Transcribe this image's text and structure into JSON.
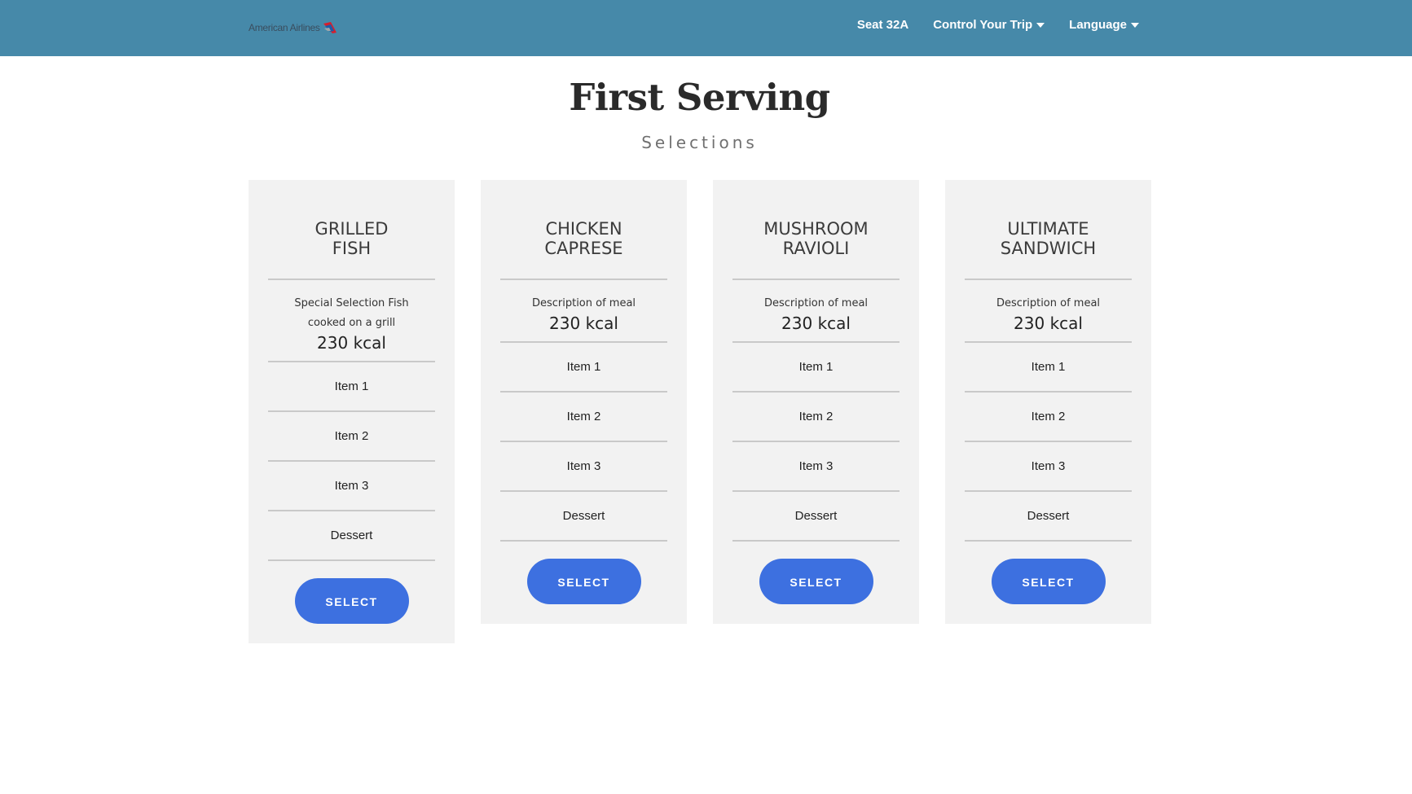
{
  "navbar": {
    "brand": "American Airlines",
    "brand_icon": "american-airlines-flight-symbol",
    "links": [
      {
        "label": "Seat 32A",
        "dropdown": false
      },
      {
        "label": "Control Your Trip",
        "dropdown": true
      },
      {
        "label": "Language",
        "dropdown": true
      }
    ],
    "background_color": "#4689a9"
  },
  "heading": {
    "title": "First Serving",
    "subtitle": "Selections"
  },
  "cards": [
    {
      "title_line1": "GRILLED",
      "title_line2": "FISH",
      "desc_line1": "Special Selection Fish",
      "desc_line2": "cooked on a grill",
      "kcal": "230 kcal",
      "items": [
        "Item 1",
        "Item 2",
        "Item 3",
        "Dessert"
      ],
      "button": "SELECT"
    },
    {
      "title_line1": "CHICKEN",
      "title_line2": "CAPRESE",
      "desc_line1": "Description of meal",
      "desc_line2": "",
      "kcal": "230 kcal",
      "items": [
        "Item 1",
        "Item 2",
        "Item 3",
        "Dessert"
      ],
      "button": "SELECT"
    },
    {
      "title_line1": "MUSHROOM",
      "title_line2": "RAVIOLI",
      "desc_line1": "Description of meal",
      "desc_line2": "",
      "kcal": "230 kcal",
      "items": [
        "Item 1",
        "Item 2",
        "Item 3",
        "Dessert"
      ],
      "button": "SELECT"
    },
    {
      "title_line1": "ULTIMATE",
      "title_line2": "SANDWICH",
      "desc_line1": "Description of meal",
      "desc_line2": "",
      "kcal": "230 kcal",
      "items": [
        "Item 1",
        "Item 2",
        "Item 3",
        "Dessert"
      ],
      "button": "SELECT"
    }
  ],
  "colors": {
    "accent": "#3d70e0",
    "card_background": "#f2f2f2"
  }
}
